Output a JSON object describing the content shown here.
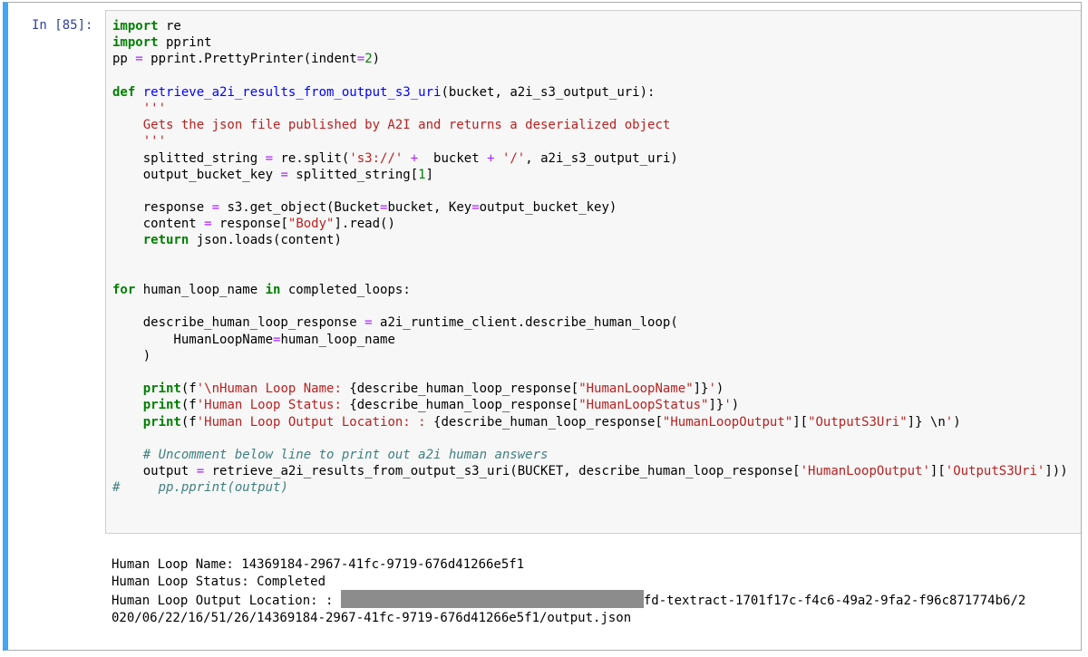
{
  "prompt": "In [85]:",
  "colors": {
    "cell_border": "#42a5f5",
    "prompt": "#303f9f",
    "keyword": "#008000",
    "string": "#ba2121",
    "function": "#0000ff",
    "operator": "#aa22ff",
    "comment": "#408080"
  },
  "code": {
    "l1_kw": "import",
    "l1_rest": " re",
    "l2_kw": "import",
    "l2_rest": " pprint",
    "l3_a": "pp ",
    "l3_op": "=",
    "l3_b": " pprint.PrettyPrinter(indent",
    "l3_op2": "=",
    "l3_num": "2",
    "l3_c": ")",
    "l5_kw": "def",
    "l5_sp": " ",
    "l5_fn": "retrieve_a2i_results_from_output_s3_uri",
    "l5_rest": "(bucket, a2i_s3_output_uri):",
    "l6_str": "    '''",
    "l7_str": "    Gets the json file published by A2I and returns a deserialized object",
    "l8_str": "    '''",
    "l9_a": "    splitted_string ",
    "l9_op": "=",
    "l9_b": " re.split(",
    "l9_str": "'s3://'",
    "l9_c": " ",
    "l9_op2": "+",
    "l9_d": "  bucket ",
    "l9_op3": "+",
    "l9_e": " ",
    "l9_str2": "'/'",
    "l9_f": ", a2i_s3_output_uri)",
    "l10_a": "    output_bucket_key ",
    "l10_op": "=",
    "l10_b": " splitted_string[",
    "l10_num": "1",
    "l10_c": "]",
    "l12_a": "    response ",
    "l12_op": "=",
    "l12_b": " s3.get_object(Bucket",
    "l12_op2": "=",
    "l12_c": "bucket, Key",
    "l12_op3": "=",
    "l12_d": "output_bucket_key)",
    "l13_a": "    content ",
    "l13_op": "=",
    "l13_b": " response[",
    "l13_str": "\"Body\"",
    "l13_c": "].read()",
    "l14_ind": "    ",
    "l14_kw": "return",
    "l14_rest": " json.loads(content)",
    "l17_kw": "for",
    "l17_a": " human_loop_name ",
    "l17_kw2": "in",
    "l17_b": " completed_loops:",
    "l19_a": "    describe_human_loop_response ",
    "l19_op": "=",
    "l19_b": " a2i_runtime_client.describe_human_loop(",
    "l20_a": "        HumanLoopName",
    "l20_op": "=",
    "l20_b": "human_loop_name",
    "l21": "    )",
    "l23_ind": "    ",
    "l23_fn": "print",
    "l23_a": "(f",
    "l23_str": "'\\nHuman Loop Name: ",
    "l23_b": "{describe_human_loop_response[",
    "l23_str2": "\"HumanLoopName\"",
    "l23_c": "]}",
    "l23_str3": "'",
    "l23_d": ")",
    "l24_ind": "    ",
    "l24_fn": "print",
    "l24_a": "(f",
    "l24_str": "'Human Loop Status: ",
    "l24_b": "{describe_human_loop_response[",
    "l24_str2": "\"HumanLoopStatus\"",
    "l24_c": "]}",
    "l24_str3": "'",
    "l24_d": ")",
    "l25_ind": "    ",
    "l25_fn": "print",
    "l25_a": "(f",
    "l25_str": "'Human Loop Output Location: : ",
    "l25_b": "{describe_human_loop_response[",
    "l25_str2": "\"HumanLoopOutput\"",
    "l25_c": "][",
    "l25_str3": "\"OutputS3Uri\"",
    "l25_d": "]} \\n",
    "l25_str4": "'",
    "l25_e": ")",
    "l27_ind": "    ",
    "l27_cm": "# Uncomment below line to print out a2i human answers",
    "l28_a": "    output ",
    "l28_op": "=",
    "l28_b": " retrieve_a2i_results_from_output_s3_uri(BUCKET, describe_human_loop_response[",
    "l28_str": "'HumanLoopOutput'",
    "l28_c": "][",
    "l28_str2": "'OutputS3Uri'",
    "l28_d": "]))",
    "l29_cm": "#",
    "l29_sp": "     ",
    "l29_cm2": "pp.pprint(output)"
  },
  "output": {
    "line1": "Human Loop Name: 14369184-2967-41fc-9719-676d41266e5f1",
    "line2": "Human Loop Status: Completed",
    "line3_prefix": "Human Loop Output Location: : ",
    "line3_suffix": "fd-textract-1701f17c-f4c6-49a2-9fa2-f96c871774b6/2",
    "line4": "020/06/22/16/51/26/14369184-2967-41fc-9719-676d41266e5f1/output.json"
  }
}
